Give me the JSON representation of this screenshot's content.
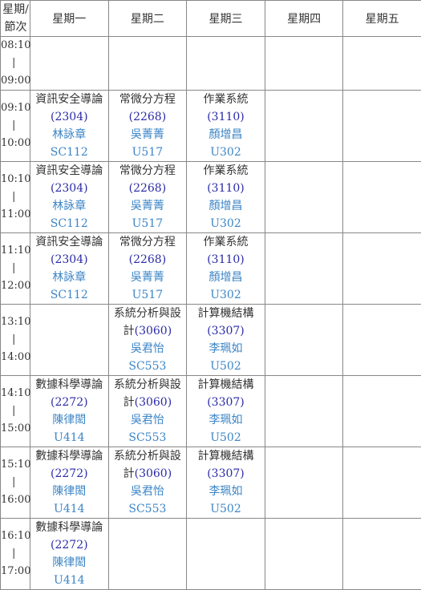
{
  "header": {
    "corner_top": "星期/",
    "corner_bottom": "節次",
    "days": [
      "星期一",
      "星期二",
      "星期三",
      "星期四",
      "星期五"
    ]
  },
  "periods": [
    {
      "start": "08:10",
      "sep": "|",
      "end": "09:00"
    },
    {
      "start": "09:10",
      "sep": "|",
      "end": "10:00"
    },
    {
      "start": "10:10",
      "sep": "|",
      "end": "11:00"
    },
    {
      "start": "11:10",
      "sep": "|",
      "end": "12:00"
    },
    {
      "start": "13:10",
      "sep": "|",
      "end": "14:00"
    },
    {
      "start": "14:10",
      "sep": "|",
      "end": "15:00"
    },
    {
      "start": "15:10",
      "sep": "|",
      "end": "16:00"
    },
    {
      "start": "16:10",
      "sep": "|",
      "end": "17:00"
    }
  ],
  "courses": {
    "infosec": {
      "name": "資訊安全導論",
      "code": "(2304)",
      "prof": "林詠章",
      "room": "SC112"
    },
    "ode": {
      "name": "常微分方程",
      "code": "(2268)",
      "prof": "吳菁菁",
      "room": "U517"
    },
    "os": {
      "name": "作業系統",
      "code": "(3110)",
      "prof": "顏增昌",
      "room": "U302"
    },
    "sa_name_a": "系統分析與設",
    "sa_name_b": "計",
    "sa": {
      "code": "(3060)",
      "prof": "吳君怡",
      "room": "SC553"
    },
    "arch": {
      "name": "計算機結構",
      "code": "(3307)",
      "prof": "李珮如",
      "room": "U502"
    },
    "ds": {
      "name": "數據科學導論",
      "code": "(2272)",
      "prof": "陳律閎",
      "room": "U414"
    }
  }
}
